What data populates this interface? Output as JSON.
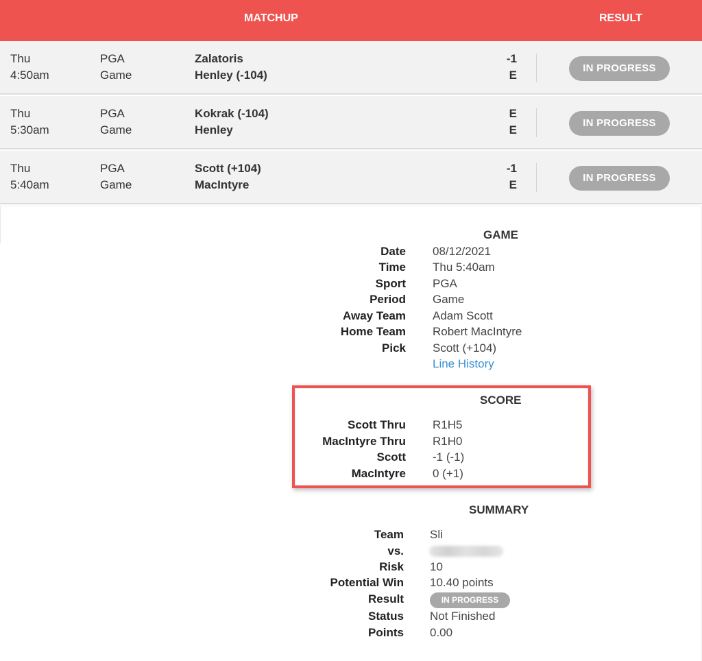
{
  "header": {
    "matchup": "MATCHUP",
    "result": "RESULT"
  },
  "rows": [
    {
      "day": "Thu",
      "time": "4:50am",
      "sport": "PGA",
      "period": "Game",
      "team1": "Zalatoris",
      "team2": "Henley (-104)",
      "score1": "-1",
      "score2": "E",
      "result": "IN PROGRESS"
    },
    {
      "day": "Thu",
      "time": "5:30am",
      "sport": "PGA",
      "period": "Game",
      "team1": "Kokrak (-104)",
      "team2": "Henley",
      "score1": "E",
      "score2": "E",
      "result": "IN PROGRESS"
    },
    {
      "day": "Thu",
      "time": "5:40am",
      "sport": "PGA",
      "period": "Game",
      "team1": "Scott (+104)",
      "team2": "MacIntyre",
      "score1": "-1",
      "score2": "E",
      "result": "IN PROGRESS"
    }
  ],
  "game": {
    "title": "GAME",
    "date_label": "Date",
    "date": "08/12/2021",
    "time_label": "Time",
    "time": "Thu 5:40am",
    "sport_label": "Sport",
    "sport": "PGA",
    "period_label": "Period",
    "period": "Game",
    "away_label": "Away Team",
    "away": "Adam Scott",
    "home_label": "Home Team",
    "home": "Robert MacIntyre",
    "pick_label": "Pick",
    "pick": "Scott (+104)",
    "line_history": "Line History"
  },
  "score": {
    "title": "SCORE",
    "scott_thru_label": "Scott Thru",
    "scott_thru": "R1H5",
    "macintyre_thru_label": "MacIntyre Thru",
    "macintyre_thru": "R1H0",
    "scott_label": "Scott",
    "scott": "-1 (-1)",
    "macintyre_label": "MacIntyre",
    "macintyre": "0 (+1)"
  },
  "summary": {
    "title": "SUMMARY",
    "team_label": "Team",
    "team": "Sli",
    "vs_label": "vs.",
    "risk_label": "Risk",
    "risk": "10",
    "win_label": "Potential Win",
    "win": "10.40 points",
    "result_label": "Result",
    "result": "IN PROGRESS",
    "status_label": "Status",
    "status": "Not Finished",
    "points_label": "Points",
    "points": "0.00"
  },
  "colors": {
    "header": "#ef5350",
    "pill": "#a8a8a8",
    "link": "#3a8fd1",
    "highlight": "#ef5350"
  }
}
